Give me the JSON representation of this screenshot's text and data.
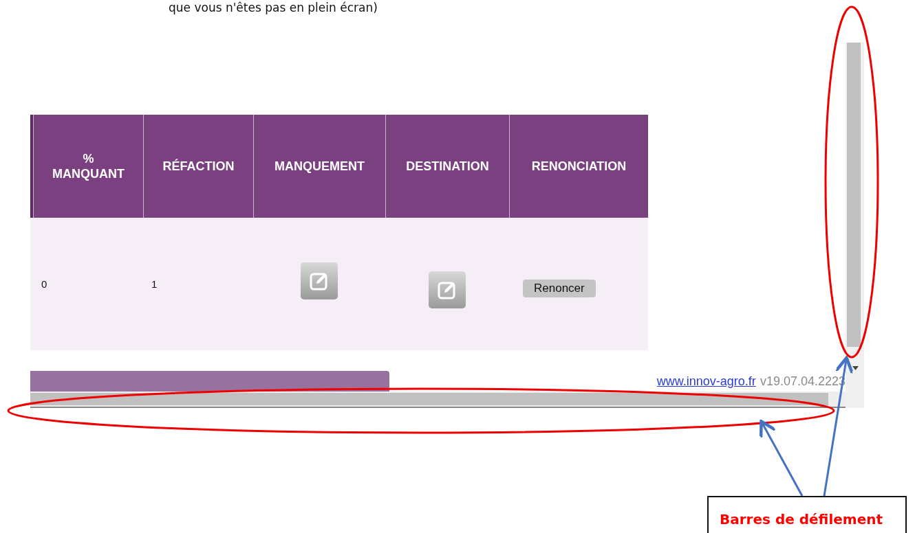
{
  "caption": "que vous n'êtes pas en plein écran)",
  "table": {
    "columns": [
      "% MANQUANT",
      "RÉFACTION",
      "MANQUEMENT",
      "DESTINATION",
      "RENONCIATION"
    ],
    "rows": [
      {
        "cells": [
          {
            "kind": "text",
            "text": "0"
          },
          {
            "kind": "text",
            "text": "1"
          },
          {
            "kind": "edit"
          },
          {
            "kind": "edit"
          },
          {
            "kind": "button",
            "text": "Renoncer"
          }
        ]
      }
    ]
  },
  "footer": {
    "link": "www.innov-agro.fr",
    "version": "v19.07.04.2223"
  },
  "callout": "Barres de défilement"
}
